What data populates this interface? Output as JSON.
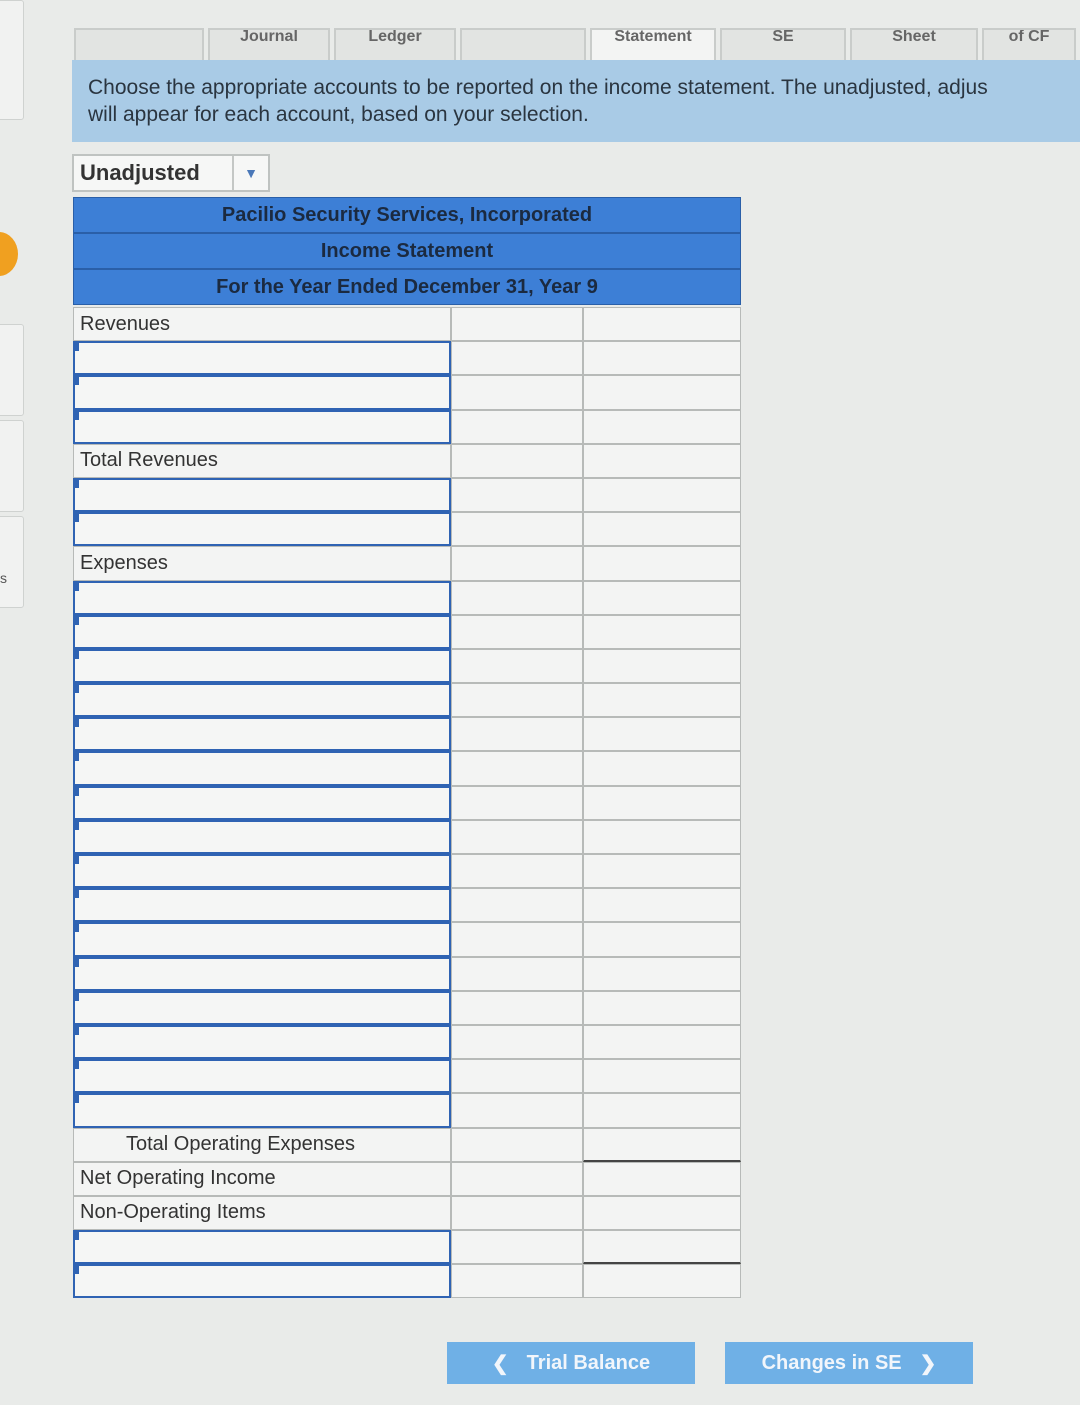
{
  "tabs": [
    {
      "label": ""
    },
    {
      "label": "Journal"
    },
    {
      "label": "Ledger"
    },
    {
      "label": ""
    },
    {
      "label": "Statement"
    },
    {
      "label": "SE"
    },
    {
      "label": "Sheet"
    },
    {
      "label": "of CF"
    }
  ],
  "instructions": {
    "line1": "Choose the appropriate accounts to be reported on the income statement. The unadjusted, adjus",
    "line2": "will appear for each account, based on your selection."
  },
  "view_select": {
    "value": "Unadjusted"
  },
  "statement": {
    "company": "Pacilio Security Services, Incorporated",
    "title": "Income Statement",
    "period": "For the Year Ended December 31, Year 9"
  },
  "labels": {
    "revenues": "Revenues",
    "total_revenues": "Total Revenues",
    "expenses": "Expenses",
    "total_operating_expenses": "Total Operating Expenses",
    "net_operating_income": "Net Operating Income",
    "non_operating_items": "Non-Operating Items"
  },
  "nav": {
    "prev_label": "Trial Balance",
    "next_label": "Changes in SE"
  },
  "gutter": {
    "text": "s"
  },
  "icons": {
    "dropdown": "caret-down-icon",
    "prev": "chevron-left-icon",
    "next": "chevron-right-icon"
  }
}
